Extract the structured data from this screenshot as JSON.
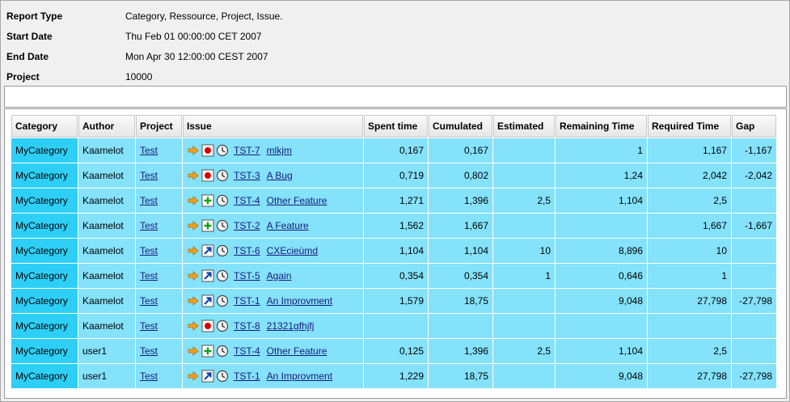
{
  "meta": [
    {
      "key": "Report Type",
      "value": "Category, Ressource, Project, Issue."
    },
    {
      "key": "Start Date",
      "value": "Thu Feb 01 00:00:00 CET 2007"
    },
    {
      "key": "End Date",
      "value": "Mon Apr 30 12:00:00 CEST 2007"
    },
    {
      "key": "Project",
      "value": "10000"
    }
  ],
  "table": {
    "headers": [
      "Category",
      "Author",
      "Project",
      "Issue",
      "Spent time",
      "Cumulated",
      "Estimated",
      "Remaining Time",
      "Required Time",
      "Gap"
    ],
    "rows": [
      {
        "category": "MyCategory",
        "author": "Kaamelot",
        "project": "Test",
        "type": "bug",
        "key": "TST-7",
        "summary": "mlkjm",
        "spent": "0,167",
        "cumulated": "0,167",
        "estimated": "",
        "remaining": "1",
        "required": "1,167",
        "gap": "-1,167"
      },
      {
        "category": "MyCategory",
        "author": "Kaamelot",
        "project": "Test",
        "type": "bug",
        "key": "TST-3",
        "summary": "A Bug",
        "spent": "0,719",
        "cumulated": "0,802",
        "estimated": "",
        "remaining": "1,24",
        "required": "2,042",
        "gap": "-2,042"
      },
      {
        "category": "MyCategory",
        "author": "Kaamelot",
        "project": "Test",
        "type": "new-feature",
        "key": "TST-4",
        "summary": "Other Feature",
        "spent": "1,271",
        "cumulated": "1,396",
        "estimated": "2,5",
        "remaining": "1,104",
        "required": "2,5",
        "gap": ""
      },
      {
        "category": "MyCategory",
        "author": "Kaamelot",
        "project": "Test",
        "type": "new-feature",
        "key": "TST-2",
        "summary": "A Feature",
        "spent": "1,562",
        "cumulated": "1,667",
        "estimated": "",
        "remaining": "",
        "required": "1,667",
        "gap": "-1,667"
      },
      {
        "category": "MyCategory",
        "author": "Kaamelot",
        "project": "Test",
        "type": "improvement",
        "key": "TST-6",
        "summary": "CXEcieùmd",
        "spent": "1,104",
        "cumulated": "1,104",
        "estimated": "10",
        "remaining": "8,896",
        "required": "10",
        "gap": ""
      },
      {
        "category": "MyCategory",
        "author": "Kaamelot",
        "project": "Test",
        "type": "improvement",
        "key": "TST-5",
        "summary": "Again",
        "spent": "0,354",
        "cumulated": "0,354",
        "estimated": "1",
        "remaining": "0,646",
        "required": "1",
        "gap": ""
      },
      {
        "category": "MyCategory",
        "author": "Kaamelot",
        "project": "Test",
        "type": "improvement",
        "key": "TST-1",
        "summary": "An Improvment",
        "spent": "1,579",
        "cumulated": "18,75",
        "estimated": "",
        "remaining": "9,048",
        "required": "27,798",
        "gap": "-27,798"
      },
      {
        "category": "MyCategory",
        "author": "Kaamelot",
        "project": "Test",
        "type": "bug",
        "key": "TST-8",
        "summary": "21321gfhjfj",
        "spent": "",
        "cumulated": "",
        "estimated": "",
        "remaining": "",
        "required": "",
        "gap": ""
      },
      {
        "category": "MyCategory",
        "author": "user1",
        "project": "Test",
        "type": "new-feature",
        "key": "TST-4",
        "summary": "Other Feature",
        "spent": "0,125",
        "cumulated": "1,396",
        "estimated": "2,5",
        "remaining": "1,104",
        "required": "2,5",
        "gap": ""
      },
      {
        "category": "MyCategory",
        "author": "user1",
        "project": "Test",
        "type": "improvement",
        "key": "TST-1",
        "summary": "An Improvment",
        "spent": "1,229",
        "cumulated": "18,75",
        "estimated": "",
        "remaining": "9,048",
        "required": "27,798",
        "gap": "-27,798"
      }
    ]
  },
  "icons": {
    "priority": "priority-arrow-icon",
    "bug": "bug-icon",
    "new-feature": "new-feature-icon",
    "improvement": "improvement-icon",
    "status": "clock-icon"
  },
  "colors": {
    "category_cell": "#2ecff6",
    "row_cell": "#84e2fb",
    "link": "#1a1a7a"
  }
}
